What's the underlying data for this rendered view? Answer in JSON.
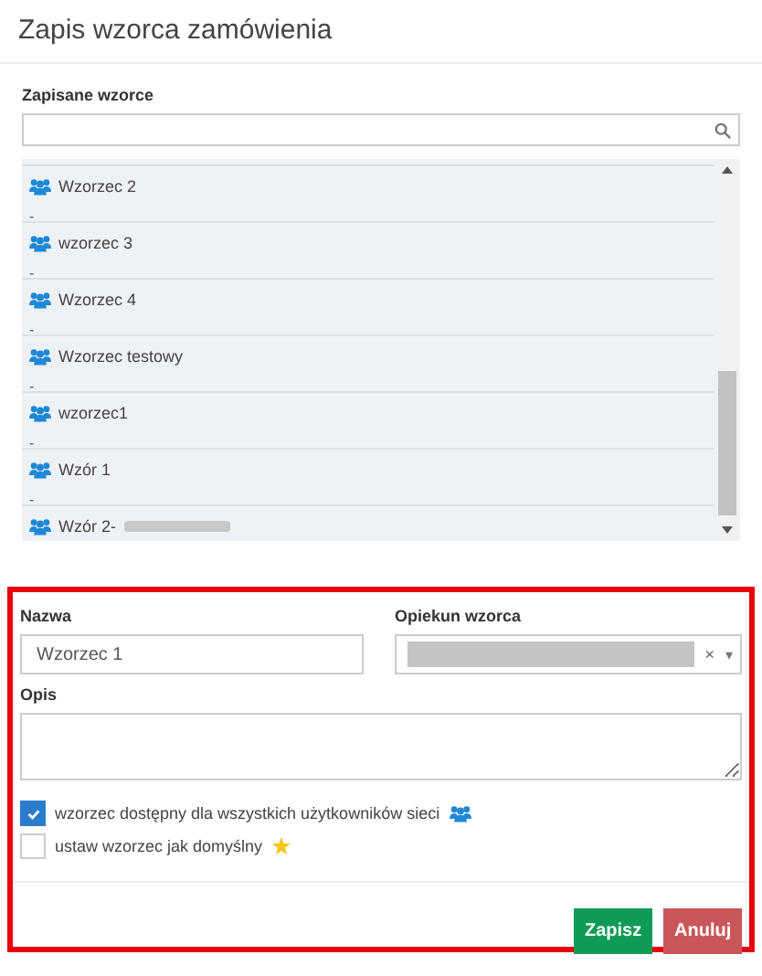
{
  "window": {
    "title": "Zapis wzorca zamówienia"
  },
  "saved_templates": {
    "label": "Zapisane wzorce",
    "items": [
      {
        "name": "Wzorzec 2",
        "description": "-"
      },
      {
        "name": "wzorzec 3",
        "description": "-"
      },
      {
        "name": "Wzorzec 4",
        "description": "-"
      },
      {
        "name": "Wzorzec testowy",
        "description": "-"
      },
      {
        "name": "wzorzec1",
        "description": "-"
      },
      {
        "name": "Wzór 1",
        "description": "-"
      },
      {
        "name": "Wzór 2-",
        "redacted": true
      }
    ]
  },
  "form": {
    "highlighted": true,
    "name": {
      "label": "Nazwa",
      "value": "Wzorzec 1"
    },
    "owner": {
      "label": "Opiekun wzorca",
      "redacted": true,
      "clear": "×",
      "caret": "▾"
    },
    "description": {
      "label": "Opis"
    },
    "options": [
      {
        "label": "wzorzec dostępny dla wszystkich użytkowników sieci",
        "checked": true,
        "kind": "shared"
      },
      {
        "label": "ustaw wzorzec jak domyślny",
        "checked": false,
        "kind": "default"
      }
    ],
    "buttons": [
      {
        "label": "Zapisz",
        "kind": "primary"
      },
      {
        "label": "Anuluj",
        "kind": "danger"
      }
    ]
  }
}
